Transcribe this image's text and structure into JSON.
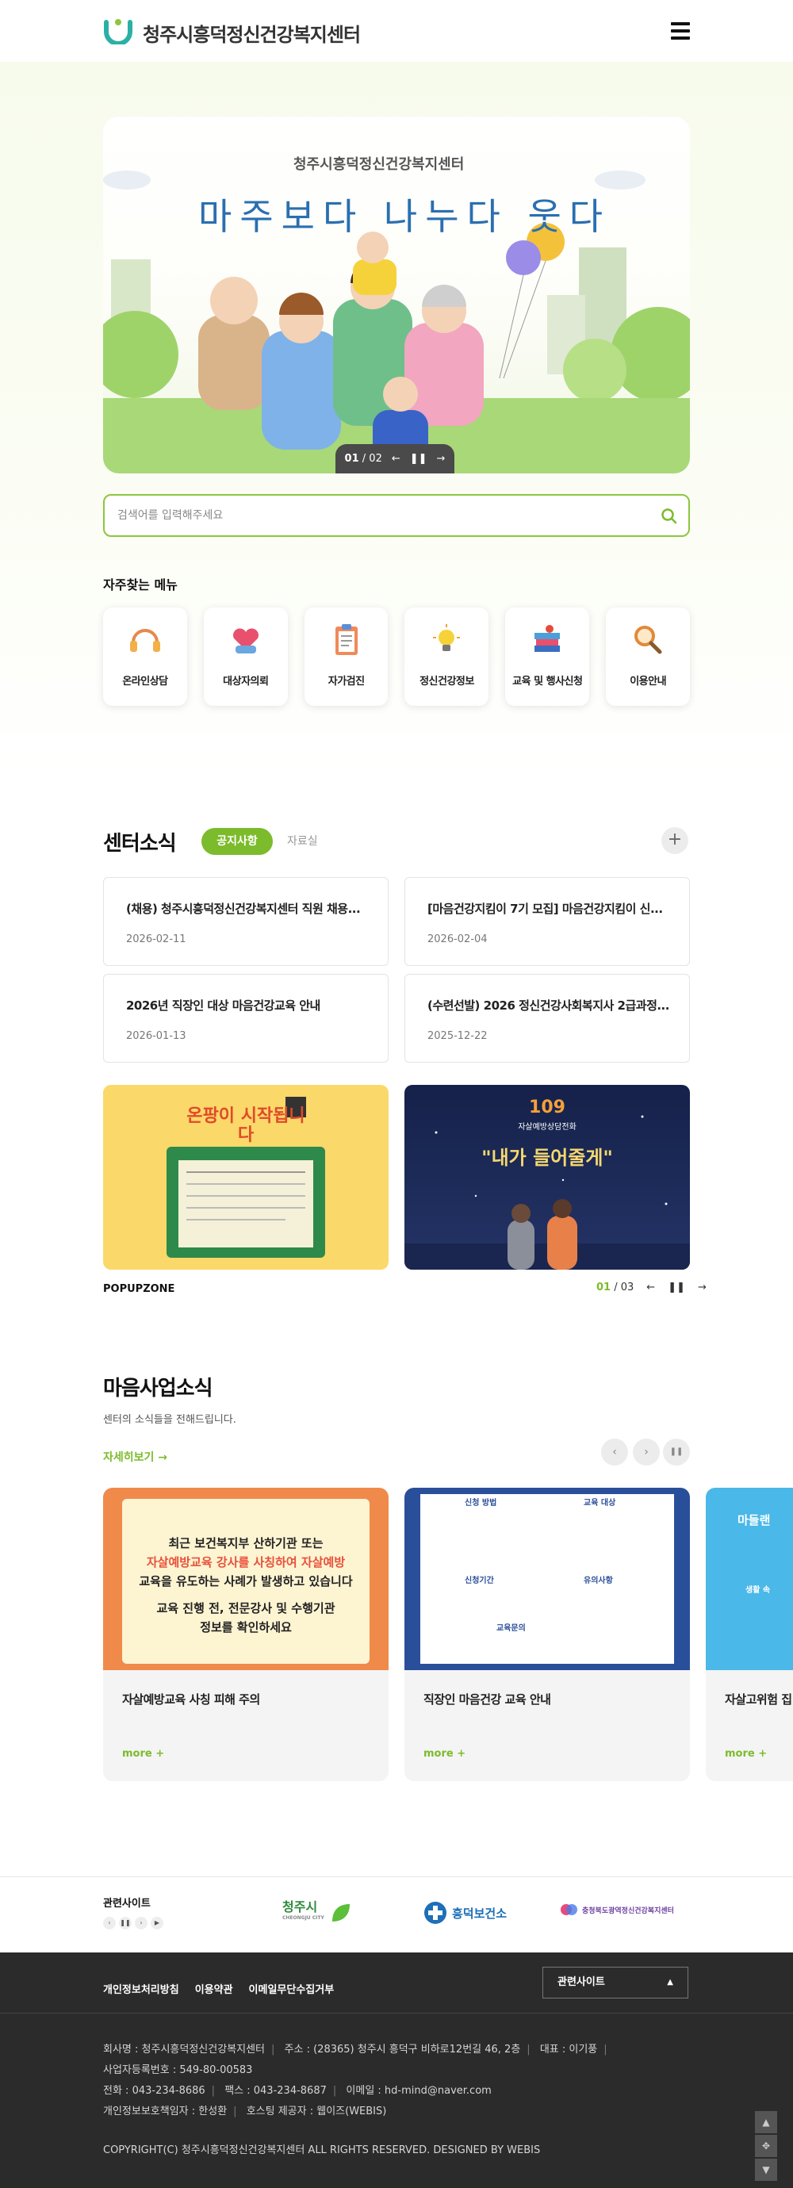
{
  "header": {
    "site_name": "청주시흥덕정신건강복지센터"
  },
  "hero": {
    "brand": "청주시흥덕정신건강복지센터",
    "slogan": "마주보다 나누다 웃다",
    "slide_current": "01",
    "slide_total": "/ 02"
  },
  "search": {
    "placeholder": "검색어를 입력해주세요"
  },
  "quick_menu": {
    "title": "자주찾는 메뉴",
    "items": [
      {
        "label": "온라인상담",
        "icon": "headset-icon"
      },
      {
        "label": "대상자의뢰",
        "icon": "heart-hand-icon"
      },
      {
        "label": "자가검진",
        "icon": "clipboard-icon"
      },
      {
        "label": "정신건강정보",
        "icon": "lightbulb-icon"
      },
      {
        "label": "교육 및 행사신청",
        "icon": "books-icon"
      },
      {
        "label": "이용안내",
        "icon": "magnifier-icon"
      }
    ]
  },
  "center_news": {
    "title": "센터소식",
    "tab_active": "공지사항",
    "tab_inactive": "자료실",
    "more": "+",
    "items": [
      {
        "title": "(채용) 청주시흥덕정신건강복지센터 직원 채용...",
        "date": "2026-02-11"
      },
      {
        "title": "[마음건강지킴이 7기 모집] 마음건강지킴이 신...",
        "date": "2026-02-04"
      },
      {
        "title": "2026년 직장인 대상 마음건강교육 안내",
        "date": "2026-01-13"
      },
      {
        "title": "(수련선발) 2026 정신건강사회복지사 2급과정...",
        "date": "2025-12-22"
      }
    ]
  },
  "popupzone": {
    "label": "POPUPZONE",
    "current": "01",
    "total": "/ 03",
    "popup1": {
      "heading": "온팡이 시작됩니다"
    },
    "popup2": {
      "number": "109",
      "caption": "자살예방상담전화",
      "quote": "\"내가 들어줄게\""
    }
  },
  "maeum_news": {
    "title": "마음사업소식",
    "subtitle": "센터의 소식들을 전해드립니다.",
    "more_link": "자세히보기 →",
    "cards": [
      {
        "title": "자살예방교육 사칭 피해 주의",
        "more": "more +",
        "img_lines": [
          "최근 보건복지부 산하기관 또는",
          "자살예방교육 강사를 사칭하여 자살예방",
          "교육을 유도하는 사례가 발생하고 있습니다",
          "교육 진행 전, 전문강사 및 수행기관",
          "정보를 확인하세요"
        ]
      },
      {
        "title": "직장인 마음건강 교육 안내",
        "more": "more +",
        "img_lines": [
          "신청 방법",
          "교육 대상",
          "신청기간",
          "유의사항",
          "교육문의"
        ]
      },
      {
        "title": "자살고위험 집",
        "more": "more +",
        "img_lines": [
          "마들랜",
          "생활 속"
        ]
      }
    ]
  },
  "related": {
    "label": "관련사이트",
    "sites": [
      {
        "name": "청주시",
        "sub": "CHEONGJU CITY",
        "color": "#2e8b3d"
      },
      {
        "name": "흥덕보건소",
        "color": "#1d6fb8"
      },
      {
        "name": "충청북도광역정신건강복지센터",
        "color": "#6a3fa0"
      }
    ]
  },
  "footer": {
    "links": [
      "개인정보처리방침",
      "이용약관",
      "이메일무단수집거부"
    ],
    "select_label": "관련사이트",
    "info_lines": [
      [
        "회사명 : 청주시흥덕정신건강복지센터",
        "주소 : (28365) 청주시 흥덕구 비하로12번길 46, 2층",
        "대표 : 이기풍"
      ],
      [
        "사업자등록번호 : 549-80-00583"
      ],
      [
        "전화 : 043-234-8686",
        "팩스 : 043-234-8687",
        "이메일 : hd-mind@naver.com"
      ],
      [
        "개인정보보호책임자 : 한성환",
        "호스팅 제공자 : 웹이즈(WEBIS)"
      ]
    ],
    "copyright": "COPYRIGHT(C) 청주시흥덕정신건강복지센터 ALL RIGHTS RESERVED. DESIGNED BY WEBIS"
  },
  "colors": {
    "accent": "#7cbb2c",
    "footer_bg": "#2b2b2b",
    "brand_blue": "#2a6fb0"
  }
}
